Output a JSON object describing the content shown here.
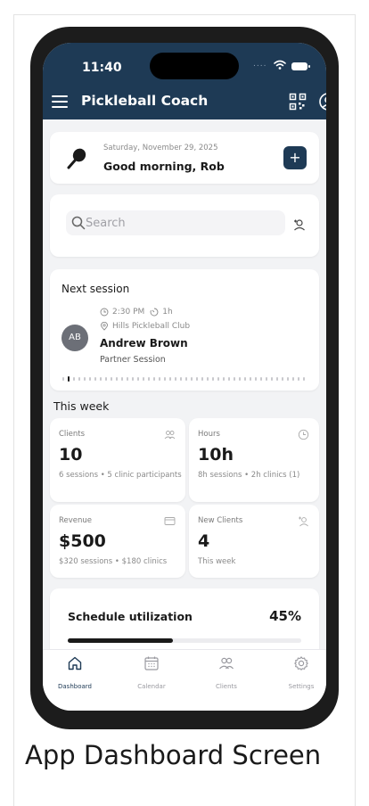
{
  "status_bar": {
    "time": "11:40",
    "signal_dots": "...."
  },
  "app_bar": {
    "title": "Pickleball Coach"
  },
  "greeting": {
    "date": "Saturday, November 29, 2025",
    "text": "Good morning, Rob",
    "add_label": "+"
  },
  "search": {
    "placeholder": "Search"
  },
  "next_session": {
    "heading": "Next session",
    "time": "2:30 PM",
    "duration": "1h",
    "location": "Hills Pickleball Club",
    "avatar_initials": "AB",
    "client_name": "Andrew Brown",
    "session_type": "Partner Session"
  },
  "this_week": {
    "title": "This week",
    "stats": [
      {
        "label": "Clients",
        "value": "10",
        "sub": "6 sessions • 5 clinic participants",
        "icon": "clients-icon"
      },
      {
        "label": "Hours",
        "value": "10h",
        "sub": "8h sessions • 2h clinics (1)",
        "icon": "clock-icon"
      },
      {
        "label": "Revenue",
        "value": "$500",
        "sub": "$320 sessions • $180 clinics",
        "icon": "card-icon"
      },
      {
        "label": "New Clients",
        "value": "4",
        "sub": "This week",
        "icon": "add-user-icon"
      }
    ]
  },
  "utilization": {
    "label": "Schedule utilization",
    "value_text": "45%",
    "fraction": 0.45
  },
  "tabs": [
    {
      "label": "Dashboard",
      "icon": "home-icon",
      "active": true
    },
    {
      "label": "Calendar",
      "icon": "calendar-icon",
      "active": false
    },
    {
      "label": "Clients",
      "icon": "clients-icon",
      "active": false
    },
    {
      "label": "Settings",
      "icon": "gear-icon",
      "active": false
    }
  ],
  "caption": "App Dashboard Screen",
  "colors": {
    "brand": "#1e3a55",
    "background": "#f2f3f5",
    "text": "#1a1a1a"
  }
}
